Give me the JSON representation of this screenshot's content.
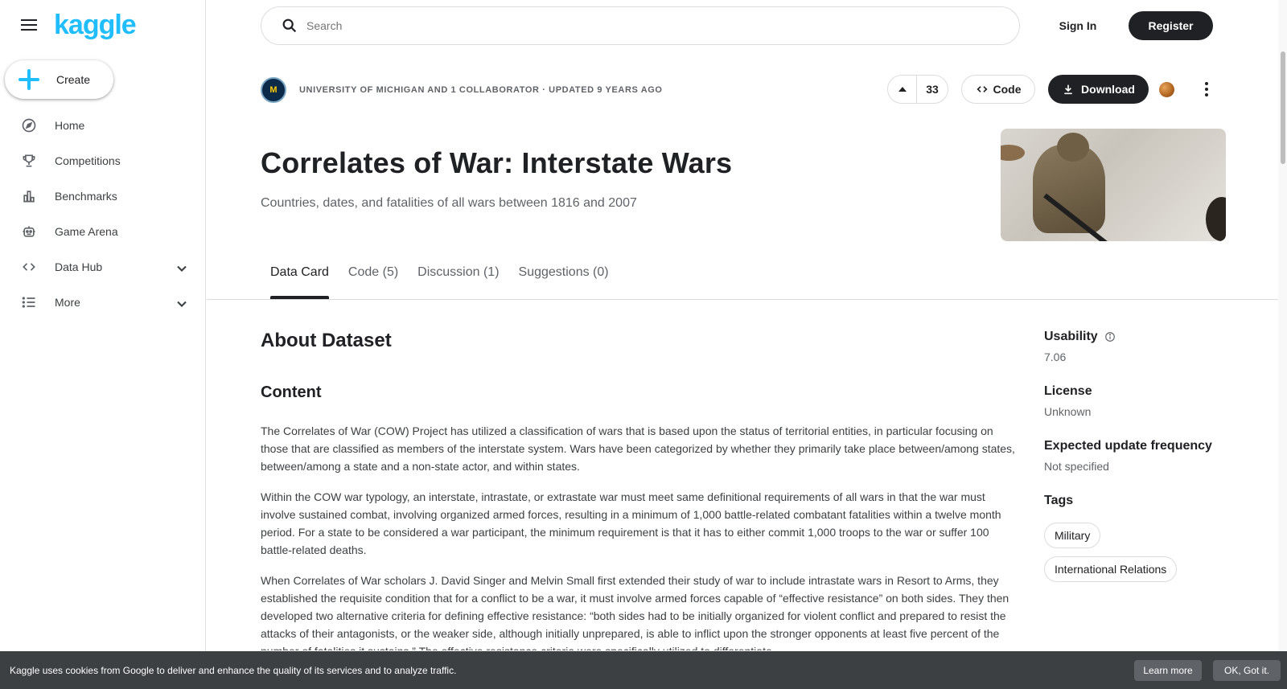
{
  "app": {
    "logo_text": "kaggle",
    "brand_color": "#20beff"
  },
  "sidebar": {
    "create_label": "Create",
    "items": [
      {
        "label": "Home",
        "icon": "compass-icon"
      },
      {
        "label": "Competitions",
        "icon": "trophy-icon"
      },
      {
        "label": "Benchmarks",
        "icon": "bar-chart-icon"
      },
      {
        "label": "Game Arena",
        "icon": "robot-icon"
      },
      {
        "label": "Data Hub",
        "icon": "code-icon",
        "expandable": true
      },
      {
        "label": "More",
        "icon": "list-icon",
        "expandable": true
      }
    ]
  },
  "topbar": {
    "search_placeholder": "Search",
    "signin_label": "Sign In",
    "register_label": "Register"
  },
  "dataset": {
    "org_avatar_text": "M",
    "owner_line": "UNIVERSITY OF MICHIGAN AND 1 COLLABORATOR · UPDATED 9 YEARS AGO",
    "upvotes": "33",
    "code_label": "Code",
    "download_label": "Download",
    "title": "Correlates of War: Interstate Wars",
    "subtitle": "Countries, dates, and fatalities of all wars between 1816 and 2007"
  },
  "tabs": [
    {
      "label": "Data Card",
      "active": true
    },
    {
      "label": "Code (5)",
      "active": false
    },
    {
      "label": "Discussion (1)",
      "active": false
    },
    {
      "label": "Suggestions (0)",
      "active": false
    }
  ],
  "content": {
    "about_heading": "About Dataset",
    "content_heading": "Content",
    "paragraphs": [
      "The Correlates of War (COW) Project has utilized a classification of wars that is based upon the status of territorial entities, in particular focusing on those that are classified as members of the interstate system. Wars have been categorized by whether they primarily take place between/among states, between/among a state and a non-state actor, and within states.",
      "Within the COW war typology, an interstate, intrastate, or extrastate war must meet same definitional requirements of all wars in that the war must involve sustained combat, involving organized armed forces, resulting in a minimum of 1,000 battle-related combatant fatalities within a twelve month period. For a state to be considered a war participant, the minimum requirement is that it has to either commit 1,000 troops to the war or suffer 100 battle-related deaths.",
      "When Correlates of War scholars J. David Singer and Melvin Small first extended their study of war to include intrastate wars in Resort to Arms, they established the requisite condition that for a conflict to be a war, it must involve armed forces capable of “effective resistance” on both sides. They then developed two alternative criteria for defining effective resistance: “both sides had to be initially organized for violent conflict and prepared to resist the attacks of their antagonists, or the weaker side, although initially unprepared, is able to inflict upon the stronger opponents at least five percent of the number of fatalities it sustains.” The effective resistance criteria were specifically utilized to differentiate"
    ]
  },
  "meta": {
    "usability_label": "Usability",
    "usability_value": "7.06",
    "license_label": "License",
    "license_value": "Unknown",
    "frequency_label": "Expected update frequency",
    "frequency_value": "Not specified",
    "tags_label": "Tags",
    "tags": [
      "Military",
      "International Relations"
    ]
  },
  "cookie": {
    "text": "Kaggle uses cookies from Google to deliver and enhance the quality of its services and to analyze traffic.",
    "learn_more": "Learn more",
    "ok": "OK, Got it."
  }
}
